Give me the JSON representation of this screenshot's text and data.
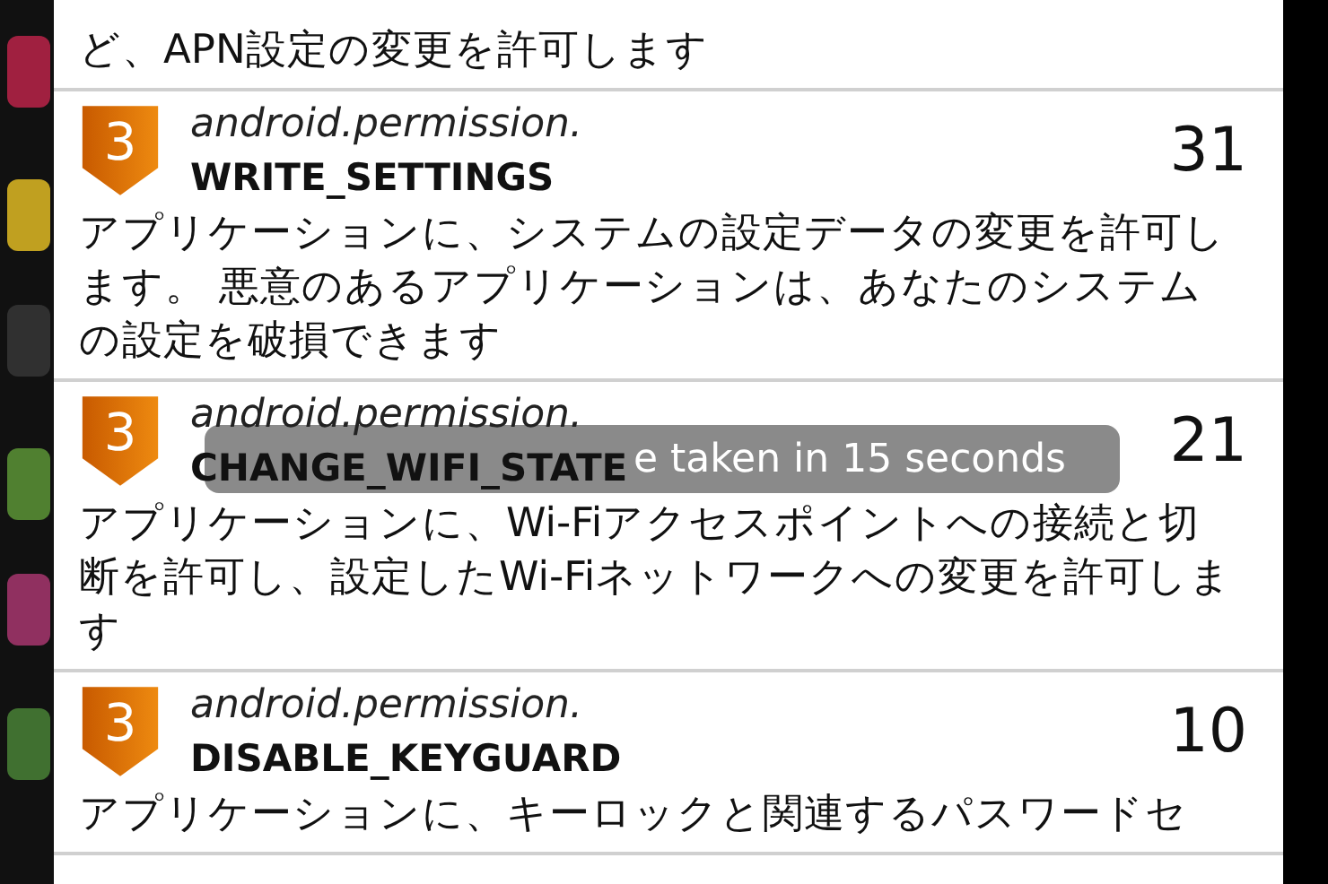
{
  "permissions": [
    {
      "description": "ど、APN設定の変更を許可します"
    },
    {
      "prefix": "android.permission.",
      "name": "WRITE_SETTINGS",
      "count": "31",
      "description": "アプリケーションに、システムの設定データの変更を許可します。 悪意のあるアプリケーションは、あなたのシステムの設定を破損できます",
      "level": "3"
    },
    {
      "prefix": "android.permission.",
      "name": "CHANGE_WIFI_STATE",
      "count": "21",
      "description": "アプリケーションに、Wi-Fiアクセスポイントへの接続と切断を許可し、設定したWi-Fiネットワークへの変更を許可します",
      "level": "3"
    },
    {
      "prefix": "android.permission.",
      "name": "DISABLE_KEYGUARD",
      "count": "10",
      "description": "アプリケーションに、キーロックと関連するパスワードセ",
      "level": "3"
    }
  ],
  "toast": {
    "text": "e taken in 15 seconds"
  }
}
